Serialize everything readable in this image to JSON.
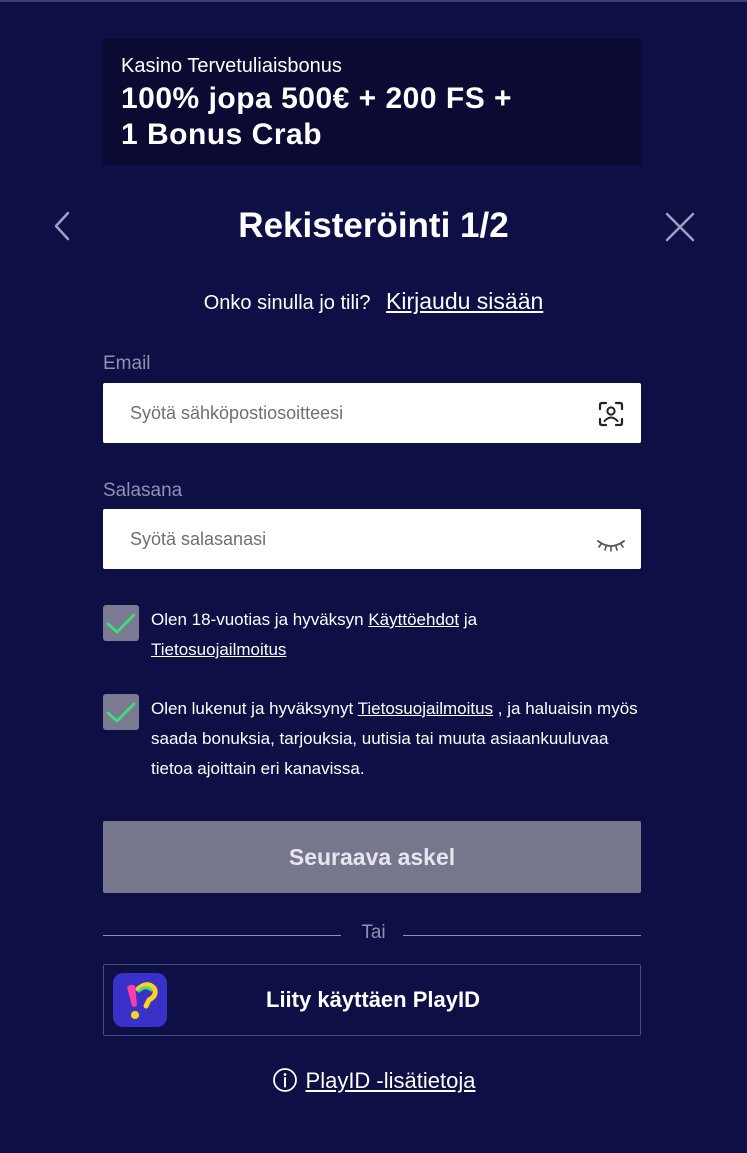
{
  "banner": {
    "subtitle": "Kasino Tervetuliaisbonus",
    "title_line1": "100% jopa 500€ + 200 FS +",
    "title_line2": "1 Bonus Crab"
  },
  "header": {
    "title": "Rekisteröinti 1/2"
  },
  "login": {
    "question": "Onko sinulla jo tili?",
    "link": "Kirjaudu sisään"
  },
  "email": {
    "label": "Email",
    "placeholder": "Syötä sähköpostiosoitteesi",
    "value": ""
  },
  "password": {
    "label": "Salasana",
    "placeholder": "Syötä salasanasi",
    "value": ""
  },
  "consent_age": {
    "checked": true,
    "text_before": "Olen 18-vuotias ja hyväksyn ",
    "terms_link": "Käyttöehdot",
    "text_middle": " ja ",
    "privacy_link": "Tietosuojailmoitus"
  },
  "consent_marketing": {
    "checked": true,
    "text_before": "Olen lukenut ja hyväksynyt ",
    "privacy_link": "Tietosuojailmoitus",
    "text_after": " , ja haluaisin myös saada bonuksia, tarjouksia, uutisia tai muuta asiaankuuluvaa tietoa ajoittain eri kanavissa."
  },
  "next_button": "Seuraava askel",
  "divider": "Tai",
  "playid": {
    "button": "Liity käyttäen PlayID",
    "info_link": "PlayID -lisätietoja"
  },
  "colors": {
    "background": "#0d0f45",
    "banner": "#0a0a33",
    "disabled_button": "#76778c",
    "check_mark": "#3fe07a",
    "playid_logo": "#3a31c9"
  }
}
